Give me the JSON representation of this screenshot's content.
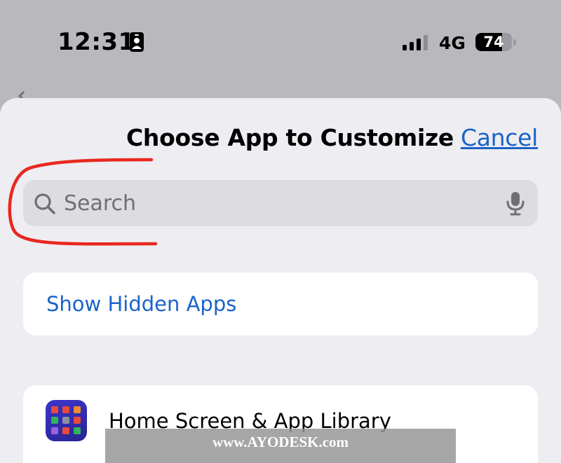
{
  "status_bar": {
    "time": "12:31",
    "network": "4G",
    "battery_percent": 74,
    "battery_label": "74"
  },
  "sheet": {
    "title": "Choose App to Customize",
    "cancel_label": "Cancel"
  },
  "search": {
    "placeholder": "Search"
  },
  "hidden_apps": {
    "label": "Show Hidden Apps"
  },
  "app_list": [
    {
      "label": "Home Screen & App Library"
    }
  ],
  "watermark": "www.AYODESK.com",
  "colors": {
    "accent": "#1a63c9",
    "annotation": "#e8281e",
    "sheet_bg": "#eeedf2"
  },
  "icons": [
    "focus-badge-icon",
    "signal-bars-icon",
    "search-icon",
    "microphone-icon",
    "home-screen-app-icon"
  ]
}
